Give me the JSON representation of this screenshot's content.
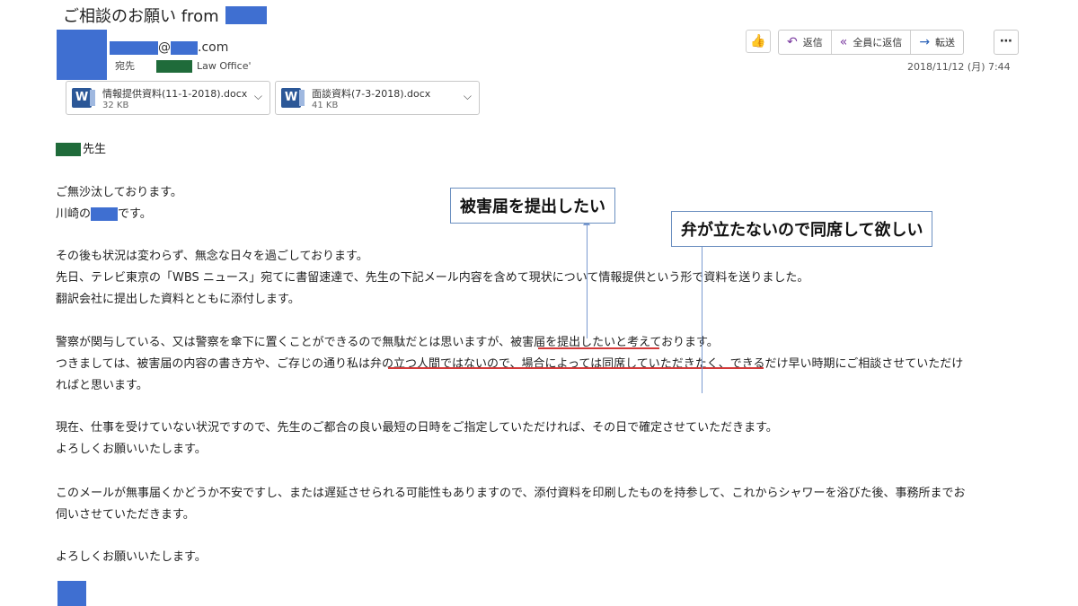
{
  "email": {
    "subject": "ご相談のお願い from",
    "sender_domain_suffix": ".com",
    "to_label": "宛先",
    "to_name": "Law Office'",
    "date": "2018/11/12 (月) 7:44"
  },
  "attachments": [
    {
      "name": "情報提供資料(11-1-2018).docx",
      "size": "32 KB"
    },
    {
      "name": "面談資料(7-3-2018).docx",
      "size": "41 KB"
    }
  ],
  "actions": {
    "reply": "返信",
    "reply_all": "全員に返信",
    "forward": "転送"
  },
  "icons": {
    "like": "thumbs-up-icon",
    "reply": "reply-icon",
    "reply_all": "reply-all-icon",
    "forward": "forward-arrow-icon",
    "more": "more-icon",
    "attachment": "word-doc-icon"
  },
  "colors": {
    "redaction_blue": "#3f6fd1",
    "redaction_green": "#1f6b3a",
    "annotation_underline": "#d33a3a",
    "annotation_arrow": "#7a9ad0"
  },
  "body": {
    "greeting_suffix": "先生",
    "line1": "ご無沙汰しております。",
    "line2_pre": "川崎の",
    "line2_post": "です。",
    "p1_l1": "その後も状況は変わらず、無念な日々を過ごしております。",
    "p1_l2": "先日、テレビ東京の「WBS ニュース」宛てに書留速達で、先生の下記メール内容を含めて現状について情報提供という形で資料を送りました。",
    "p1_l3": "翻訳会社に提出した資料とともに添付します。",
    "p2_l1": "警察が関与している、又は警察を傘下に置くことができるので無駄だとは思いますが、被害届を提出したいと考えております。",
    "p2_l2": "つきましては、被害届の内容の書き方や、ご存じの通り私は弁の立つ人間ではないので、場合によっては同席していただきたく、できるだけ早い時期にご相談させていただけ",
    "p2_l3": "ればと思います。",
    "p3_l1": "現在、仕事を受けていない状況ですので、先生のご都合の良い最短の日時をご指定していただければ、その日で確定させていただきます。",
    "p3_l2": "よろしくお願いいたします。",
    "p4_l1": "このメールが無事届くかどうか不安ですし、または遅延させられる可能性もありますので、添付資料を印刷したものを持参して、これからシャワーを浴びた後、事務所までお",
    "p4_l2": "伺いさせていただきます。",
    "closing": "よろしくお願いいたします。"
  },
  "annotations": {
    "callout1": "被害届を提出したい",
    "callout2": "弁が立たないので同席して欲しい"
  }
}
